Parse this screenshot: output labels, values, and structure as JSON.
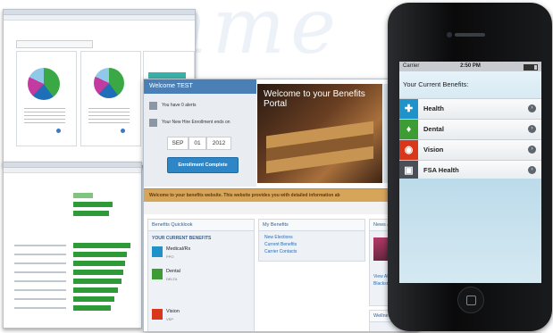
{
  "portal": {
    "welcome_header": "Welcome TEST",
    "alerts_text": "You have 0 alerts",
    "enrollment_text": "Your New Hire Enrollment ends on",
    "date": {
      "month": "SEP",
      "day": "01",
      "year": "2012"
    },
    "enroll_button": "Enrollment Complete",
    "hero_title": "Welcome to your Benefits Portal",
    "banner": "Welcome to your benefits website. This website provides you with detailed information ab",
    "quicklook": {
      "title": "Benefits Quicklook",
      "subtitle": "YOUR CURRENT BENEFITS",
      "items": [
        {
          "name": "Medical/Rx",
          "sub": "PPO",
          "color": "#1f93c9"
        },
        {
          "name": "Dental",
          "sub": "DELTA",
          "color": "#3e9c35"
        },
        {
          "name": "Vision",
          "sub": "VSP",
          "color": "#d9371b"
        }
      ]
    },
    "my_benefits": {
      "title": "My Benefits",
      "links": [
        "New Elections",
        "Current Benefits",
        "Carrier Contacts"
      ]
    },
    "news": {
      "title": "News &",
      "link1": "View All",
      "link2": "Blacksm"
    },
    "footer": "Wellness"
  },
  "phone": {
    "carrier": "Carrier",
    "time": "2:50 PM",
    "header": "Your Current Benefits:",
    "benefits": [
      {
        "label": "Health",
        "color": "#1f93c9",
        "glyph": "✚",
        "icon": "health-icon"
      },
      {
        "label": "Dental",
        "color": "#3e9c35",
        "glyph": "♦",
        "icon": "tooth-icon"
      },
      {
        "label": "Vision",
        "color": "#d9371b",
        "glyph": "◉",
        "icon": "eye-icon"
      },
      {
        "label": "FSA Health",
        "color": "#4a4f57",
        "glyph": "▣",
        "icon": "card-icon"
      }
    ]
  },
  "background_text": "mme"
}
